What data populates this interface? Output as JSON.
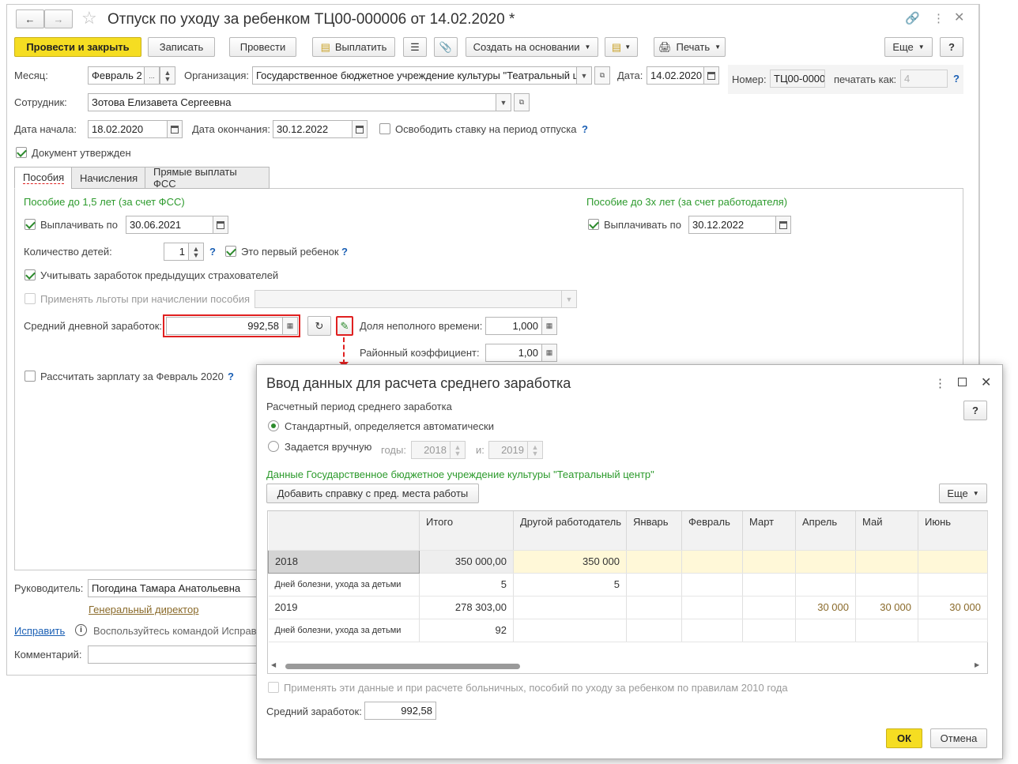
{
  "window": {
    "title": "Отпуск по уходу за ребенком ТЦ00-000006 от 14.02.2020 *"
  },
  "toolbar": {
    "post_close": "Провести и закрыть",
    "save": "Записать",
    "post": "Провести",
    "pay": "Выплатить",
    "create_based": "Создать на основании",
    "print": "Печать",
    "more": "Еще",
    "help": "?"
  },
  "header": {
    "month_label": "Месяц:",
    "month_value": "Февраль 2",
    "org_label": "Организация:",
    "org_value": "Государственное бюджетное учреждение культуры \"Театральный ц",
    "date_label": "Дата:",
    "date_value": "14.02.2020",
    "number_label": "Номер:",
    "number_value": "ТЦ00-0000",
    "print_as_label": "печатать как:",
    "print_as_value": "4",
    "employee_label": "Сотрудник:",
    "employee_value": "Зотова Елизавета Сергеевна",
    "start_label": "Дата начала:",
    "start_value": "18.02.2020",
    "end_label": "Дата окончания:",
    "end_value": "30.12.2022",
    "free_rate_label": "Освободить ставку на период отпуска",
    "approved_label": "Документ утвержден"
  },
  "tabs": [
    "Пособия",
    "Начисления",
    "Прямые выплаты ФСС"
  ],
  "benefits": {
    "left_title": "Пособие до 1,5 лет (за счет ФСС)",
    "right_title": "Пособие до 3х лет (за счет работодателя)",
    "pay_until_label": "Выплачивать по",
    "left_pay_until": "30.06.2021",
    "right_pay_until": "30.12.2022",
    "children_label": "Количество детей:",
    "children_value": "1",
    "first_child_label": "Это первый ребенок",
    "prev_insurers_label": "Учитывать заработок предыдущих страхователей",
    "privileges_label": "Применять льготы при начислении пособия",
    "avg_daily_label": "Средний дневной заработок:",
    "avg_daily_value": "992,58",
    "part_time_label": "Доля неполного времени:",
    "part_time_value": "1,000",
    "regional_label": "Районный коэффициент:",
    "regional_value": "1,00",
    "calc_salary_label": "Рассчитать зарплату за Февраль 2020"
  },
  "footer": {
    "manager_label": "Руководитель:",
    "manager_value": "Погодина Тамара Анатольевна",
    "manager_position": "Генеральный директор",
    "fix_link": "Исправить",
    "fix_hint": "Воспользуйтесь командой Исправ",
    "comment_label": "Комментарий:"
  },
  "dialog": {
    "title": "Ввод данных для расчета среднего заработка",
    "period_label": "Расчетный период среднего заработка",
    "standard_option": "Стандартный, определяется автоматически",
    "manual_option": "Задается вручную",
    "years_label": "годы:",
    "year1": "2018",
    "and_label": "и:",
    "year2": "2019",
    "data_title": "Данные Государственное бюджетное учреждение культуры \"Театральный центр\"",
    "add_cert_button": "Добавить справку с пред. места работы",
    "more_button": "Еще",
    "columns": [
      "",
      "Итого",
      "Другой работодатель",
      "Январь",
      "Февраль",
      "Март",
      "Апрель",
      "Май",
      "Июнь"
    ],
    "rows": [
      [
        "2018",
        "350 000,00",
        "350 000",
        "",
        "",
        "",
        "",
        "",
        ""
      ],
      [
        "Дней болезни, ухода за детьми",
        "5",
        "5",
        "",
        "",
        "",
        "",
        "",
        ""
      ],
      [
        "2019",
        "278 303,00",
        "",
        "",
        "",
        "",
        "30 000",
        "30 000",
        "30 000"
      ],
      [
        "Дней болезни, ухода за детьми",
        "92",
        "",
        "",
        "",
        "",
        "",
        "",
        ""
      ]
    ],
    "apply_2010_label": "Применять эти данные и при расчете больничных, пособий по уходу за ребенком по правилам 2010 года",
    "avg_salary_label": "Средний заработок:",
    "avg_salary_value": "992,58",
    "ok": "ОК",
    "cancel": "Отмена"
  }
}
